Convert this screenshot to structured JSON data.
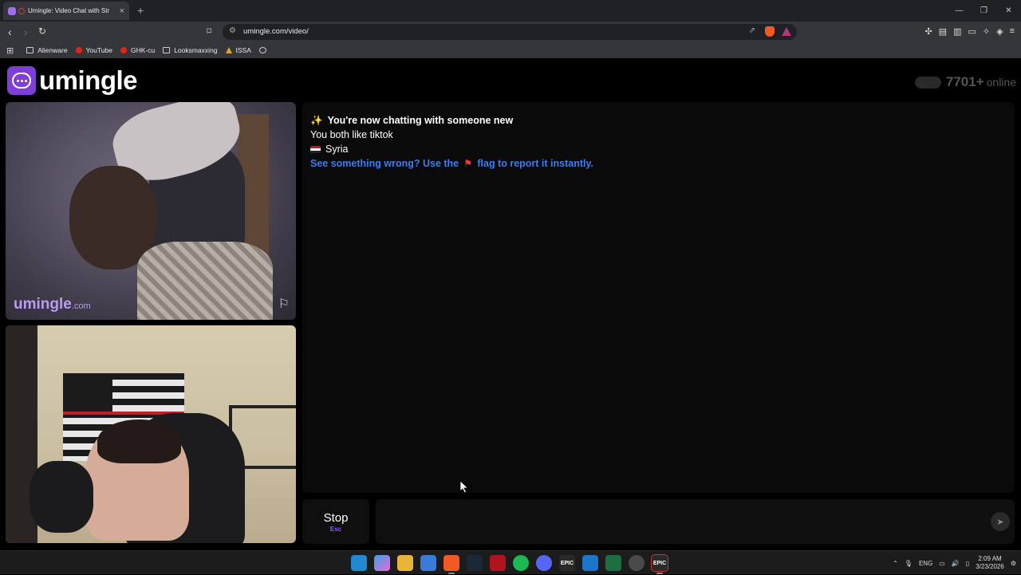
{
  "browser": {
    "tab_title": "Umingle: Video Chat with Str",
    "tab_close": "×",
    "new_tab": "+",
    "url": "umingle.com/video/",
    "window_controls": [
      "—",
      "❐",
      "✕"
    ],
    "bookmarks": [
      {
        "label": "Alienware",
        "icon": "folder-icon"
      },
      {
        "label": "YouTube",
        "icon": "youtube-icon"
      },
      {
        "label": "GHK-cu",
        "icon": "youtube-icon"
      },
      {
        "label": "Looksmaxxing",
        "icon": "folder-icon"
      },
      {
        "label": "ISSA",
        "icon": "issa-icon"
      },
      {
        "label": "",
        "icon": "globe-icon"
      }
    ]
  },
  "site": {
    "logo_text": "umingle",
    "online_count": "7701+",
    "online_label": "online",
    "watermark_main": "umingle",
    "watermark_suffix": ".com"
  },
  "chat": {
    "messages": [
      {
        "text": "You're now chatting with someone new",
        "icon": "sparkles-icon",
        "style": "bold"
      },
      {
        "text": "You both like tiktok",
        "style": "normal"
      },
      {
        "text": "Syria",
        "icon": "syria-flag-icon",
        "style": "normal"
      },
      {
        "text_before": "See something wrong? Use the",
        "text_after": "flag to report it instantly.",
        "icon": "red-flag-icon",
        "style": "link"
      }
    ]
  },
  "controls": {
    "stop_label": "Stop",
    "stop_shortcut": "Esc",
    "message_placeholder": ""
  },
  "taskbar": {
    "language": "ENG",
    "time": "2:09 AM",
    "date": "3/23/2026",
    "apps": [
      "windows-start-icon",
      "copilot-icon",
      "file-explorer-icon",
      "store-icon",
      "brave-icon",
      "steam-icon",
      "app-red-icon",
      "spotify-icon",
      "discord-icon",
      "epic-games-icon",
      "edge-icon",
      "excel-icon",
      "chrome-icon",
      "epic-games-active-icon"
    ],
    "epic_label": "EPIC"
  },
  "colors": {
    "brand_purple": "#7d3fd8",
    "link_blue": "#3d7ef0",
    "shortcut_purple": "#8b5cf6"
  }
}
